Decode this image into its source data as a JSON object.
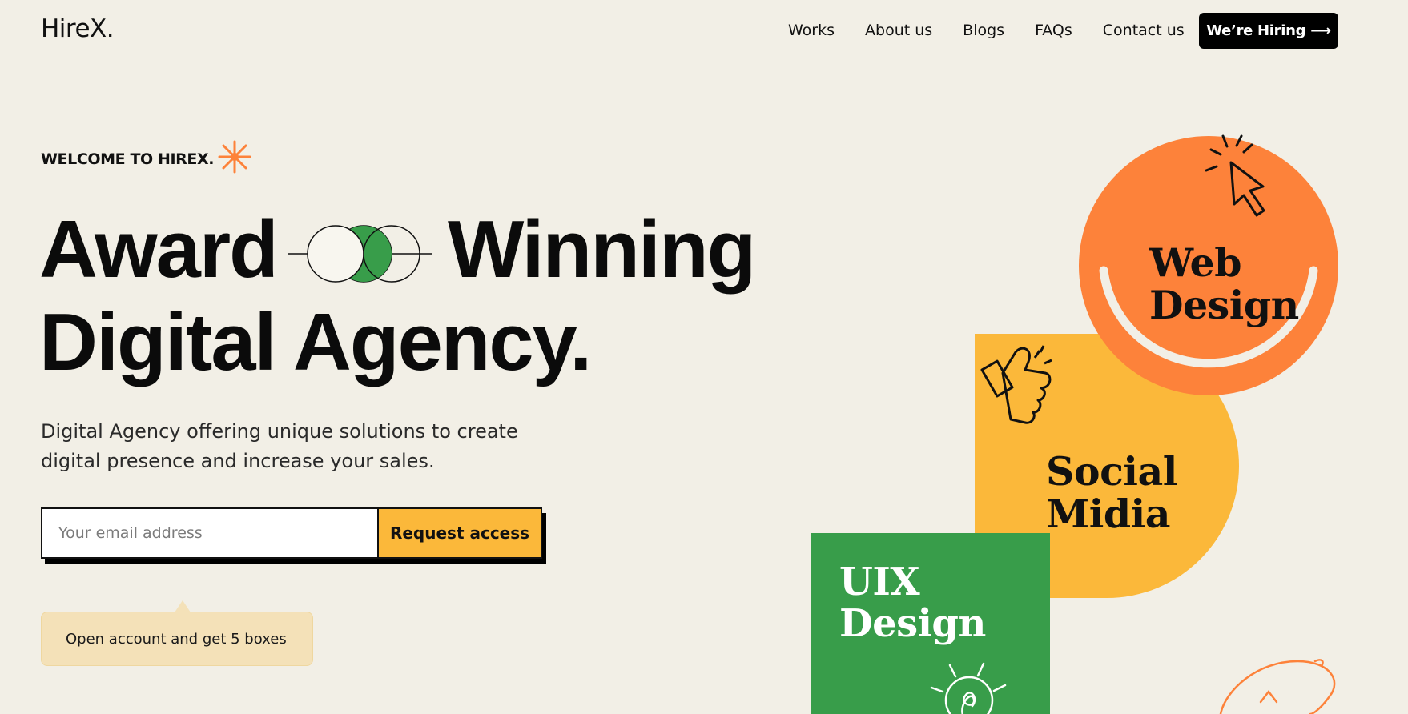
{
  "brand": {
    "logo": "HireX."
  },
  "nav": {
    "items": [
      "Works",
      "About us",
      "Blogs",
      "FAQs",
      "Contact us"
    ],
    "cta": "We’re Hiring",
    "cta_arrow": "⟶"
  },
  "hero": {
    "welcome": "WELCOME TO HIREX.",
    "headline_word1": "Award",
    "headline_word2": "Winning",
    "headline_line2": "Digital Agency.",
    "lead": "Digital Agency offering unique solutions to create digital presence and increase your sales.",
    "email_placeholder": "Your email address",
    "request_button": "Request access",
    "tooltip": "Open account and get 5 boxes"
  },
  "services": {
    "web_line1": "Web",
    "web_line2": "Design",
    "social_line1": "Social",
    "social_line2": "Midia",
    "uix_line1": "UIX",
    "uix_line2": "Design"
  },
  "colors": {
    "background": "#f2efe6",
    "orange": "#fd823a",
    "yellow": "#fbb83a",
    "green": "#389d4a",
    "black": "#000000",
    "tooltip_bg": "#f4e1b8"
  },
  "icons": [
    "sparkle-icon",
    "overlap-circles-icon",
    "cursor-click-icon",
    "thumbs-up-icon",
    "lightbulb-icon",
    "arrow-right-icon"
  ]
}
